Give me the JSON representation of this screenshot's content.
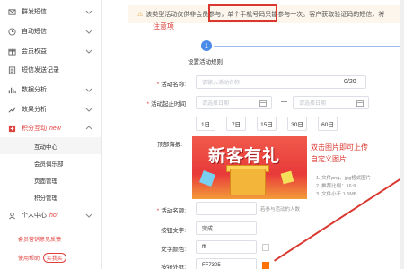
{
  "sidebar": {
    "items": [
      {
        "label": "群发短信",
        "icon": "mail-icon"
      },
      {
        "label": "自动短信",
        "icon": "clock-icon"
      },
      {
        "label": "会员权益",
        "icon": "gift-icon"
      },
      {
        "label": "短信发送记录",
        "icon": "list-icon"
      },
      {
        "label": "数据分析",
        "icon": "chart-icon"
      },
      {
        "label": "效果分析",
        "icon": "trend-icon"
      },
      {
        "label": "积分互动",
        "tag": "new",
        "icon": "points-icon"
      }
    ],
    "sub_items": [
      "互动中心",
      "会员俱乐部",
      "页面管理",
      "积分管理"
    ],
    "personal": {
      "label": "个人中心",
      "tag": "hot"
    },
    "feedback": "会员营销意见反馈",
    "help_prefix": "使用帮助",
    "help_button": "买我买"
  },
  "main": {
    "notice": "该类型活动仅供非会员参与，单个手机号码只能参与一次。客户获取验证码的短信，将",
    "note_label": "注意项",
    "step_number": "1",
    "step_label": "设置活动规则",
    "form": {
      "name_label": "活动名称:",
      "name_placeholder": "请输入活动名称",
      "name_count": "0/20",
      "time_label": "活动起止时间",
      "start_placeholder": "请选择日期",
      "end_placeholder": "请选择日期",
      "range_sep": "—",
      "day_buttons": [
        "1日",
        "7日",
        "15日",
        "30日",
        "60日"
      ],
      "poster_label": "顶部海报:",
      "poster_text": "新客有礼",
      "poster_tip_line1": "双击图片即可上传",
      "poster_tip_line2": "自定义图片",
      "poster_info_line1": "1. 文件png、jpg格式图片",
      "poster_info_line2": "2. 推荐比例：16:9",
      "poster_info_line3": "3. 文件小于 1.5MB",
      "count_label": "活动名额:",
      "count_hint": "若参与活动的人数",
      "button_text_label": "按钮文字:",
      "button_text_value": "完成",
      "text_color_label": "文字颜色:",
      "text_color_value": "fff",
      "border_label": "按钮外框:",
      "border_value": "FF7305"
    }
  },
  "colors": {
    "accent": "#e0413d",
    "highlight": "#d9372f",
    "step": "#4a8be8",
    "button_border": "#FF7305"
  }
}
